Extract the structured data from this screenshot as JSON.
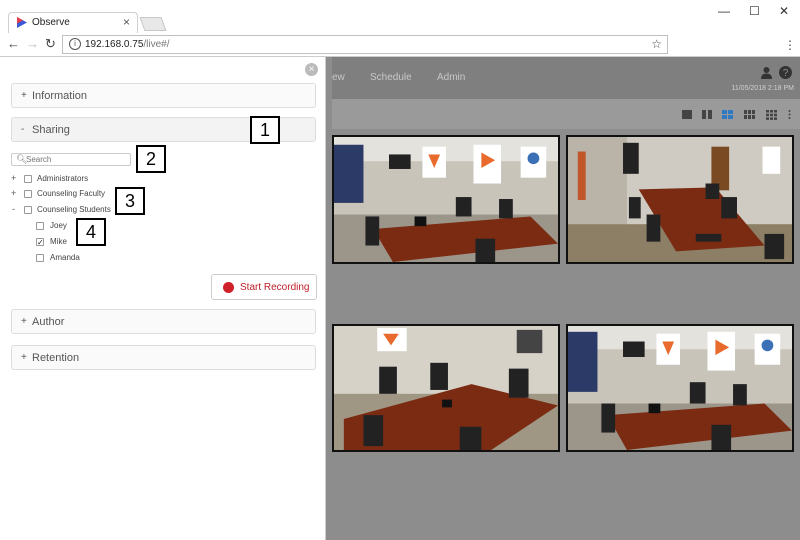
{
  "browser": {
    "tab_title": "Observe",
    "tab_close": "×",
    "url_host": "192.168.0.75",
    "url_path": "/live#/",
    "info_icon": "i",
    "back_glyph": "←",
    "forward_glyph": "→",
    "reload_glyph": "↻",
    "star_glyph": "☆",
    "menu_glyph": "⋮",
    "minimize_glyph": "—",
    "maximize_glyph": "☐",
    "close_glyph": "✕"
  },
  "app_nav": {
    "items": [
      "ew",
      "Schedule",
      "Admin"
    ],
    "date": "11/05/2018 2:18 PM",
    "user_icon": "user-icon",
    "help_icon": "help-icon"
  },
  "toolbar": {
    "icons": [
      "layout-1x1-icon",
      "layout-2x1-icon",
      "layout-2x2-icon",
      "layout-3x2-icon",
      "layout-3x3-icon",
      "fullscreen-icon",
      "more-icon"
    ],
    "active_index": 2
  },
  "panel": {
    "close_glyph": "×",
    "sections": [
      {
        "sign": "+",
        "label": "Information"
      },
      {
        "sign": "-",
        "label": "Sharing"
      },
      {
        "sign": "+",
        "label": "Author"
      },
      {
        "sign": "+",
        "label": "Retention"
      }
    ],
    "search_placeholder": "Search",
    "tree": [
      {
        "expander": "+",
        "label": "Administrators",
        "checked": false
      },
      {
        "expander": "+",
        "label": "Counseling Faculty",
        "checked": false
      },
      {
        "expander": "-",
        "label": "Counseling Students",
        "checked": false
      },
      {
        "expander": "",
        "label": "Joey",
        "checked": false
      },
      {
        "expander": "",
        "label": "Mike",
        "checked": true
      },
      {
        "expander": "",
        "label": "Amanda",
        "checked": false
      }
    ],
    "record_label": "Start Recording"
  },
  "callouts": [
    "1",
    "2",
    "3",
    "4"
  ],
  "colors": {
    "record_red": "#d0202a",
    "accent_blue": "#2f7ac0",
    "overlay_gray": "#8d8d8d"
  }
}
